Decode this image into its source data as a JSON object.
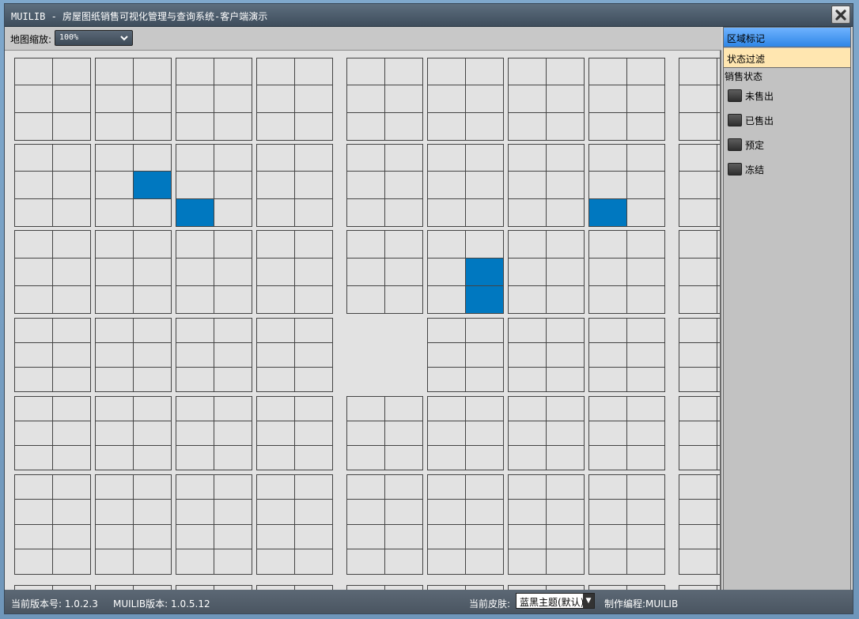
{
  "window": {
    "title": "MUILIB - 房屋图纸销售可视化管理与查询系统-客户端演示"
  },
  "toolbar": {
    "zoom_label": "地图缩放:",
    "zoom_value": "100%"
  },
  "panel": {
    "tab_region": "区域标记",
    "tab_filter": "状态过滤",
    "section_label": "销售状态",
    "legend": [
      {
        "label": "未售出"
      },
      {
        "label": "已售出"
      },
      {
        "label": "预定"
      },
      {
        "label": "冻结"
      }
    ]
  },
  "status": {
    "version": "当前版本号: 1.0.2.3",
    "muilib_version": "MUILIB版本: 1.0.5.12",
    "skin_label": "当前皮肤:",
    "skin_value": "蓝黑主题(默认)",
    "author": "制作编程:MUILIB"
  },
  "map": {
    "sold_color": "#0078c0",
    "sold_units": 6
  }
}
